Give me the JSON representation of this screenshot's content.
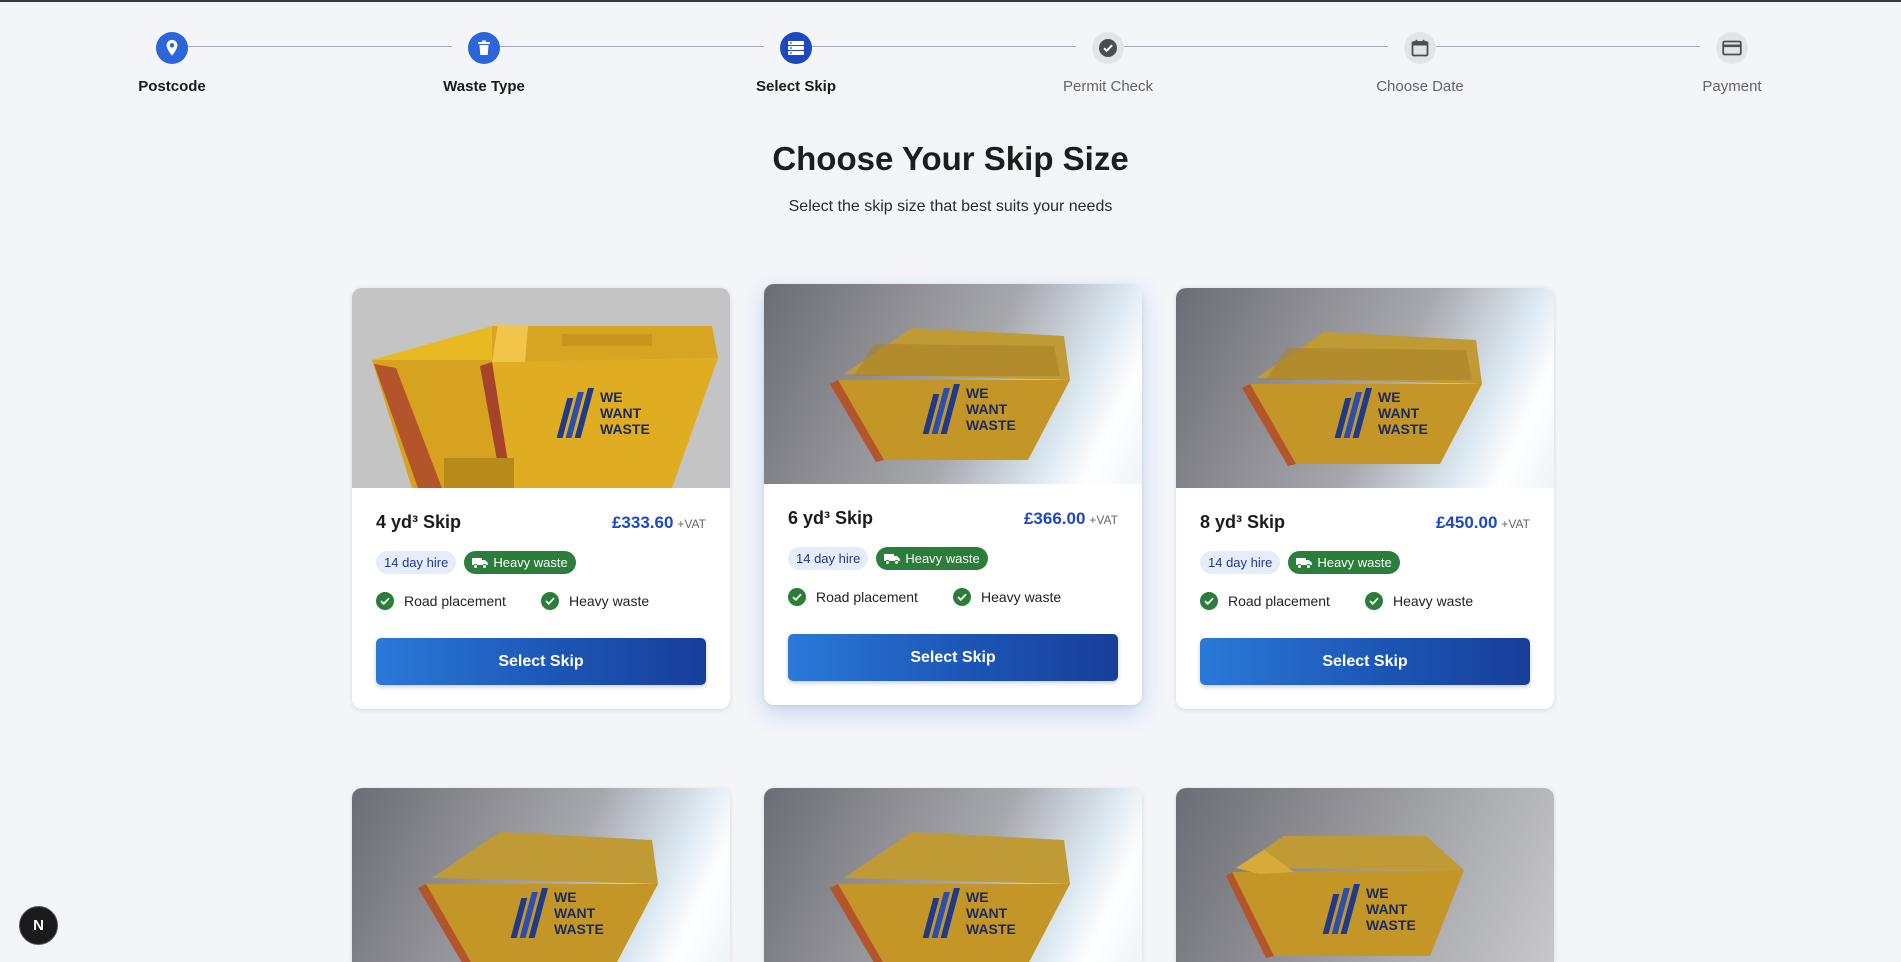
{
  "stepper": {
    "steps": [
      {
        "label": "Postcode",
        "icon": "map-pin-icon",
        "state": "done"
      },
      {
        "label": "Waste Type",
        "icon": "trash-icon",
        "state": "done"
      },
      {
        "label": "Select Skip",
        "icon": "stack-icon",
        "state": "active"
      },
      {
        "label": "Permit Check",
        "icon": "check-circle-icon",
        "state": "todo"
      },
      {
        "label": "Choose Date",
        "icon": "calendar-icon",
        "state": "todo"
      },
      {
        "label": "Payment",
        "icon": "credit-card-icon",
        "state": "todo"
      }
    ]
  },
  "heading": {
    "title": "Choose Your Skip Size",
    "subtitle": "Select the skip size that best suits your needs"
  },
  "skips": [
    {
      "title": "4 yd³ Skip",
      "price": "£333.60",
      "vat": "+VAT",
      "hire": "14 day hire",
      "badge": "Heavy waste",
      "features": [
        "Road placement",
        "Heavy waste"
      ],
      "button": "Select Skip"
    },
    {
      "title": "6 yd³ Skip",
      "price": "£366.00",
      "vat": "+VAT",
      "hire": "14 day hire",
      "badge": "Heavy waste",
      "features": [
        "Road placement",
        "Heavy waste"
      ],
      "button": "Select Skip"
    },
    {
      "title": "8 yd³ Skip",
      "price": "£450.00",
      "vat": "+VAT",
      "hire": "14 day hire",
      "badge": "Heavy waste",
      "features": [
        "Road placement",
        "Heavy waste"
      ],
      "button": "Select Skip"
    }
  ],
  "brand": {
    "logo_lines": [
      "WE",
      "WANT",
      "WASTE"
    ]
  },
  "colors": {
    "accent": "#1d47c4",
    "success": "#2b7d3a",
    "skip_yellow": "#d6a21f"
  },
  "fab": {
    "label": "N"
  }
}
